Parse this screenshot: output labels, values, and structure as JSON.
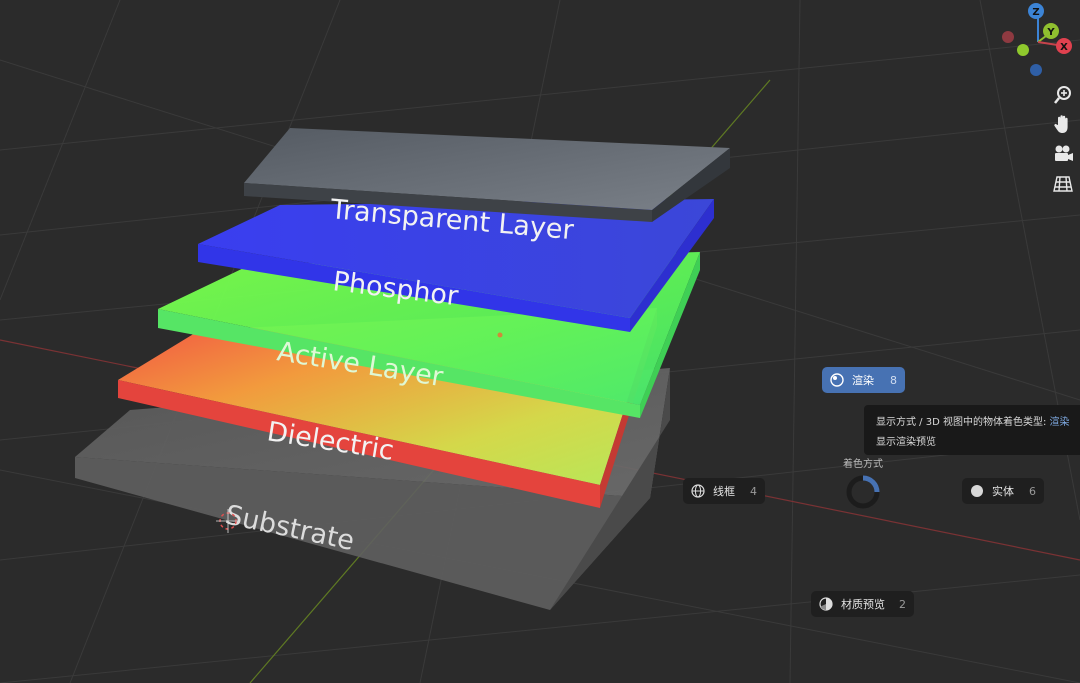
{
  "scene": {
    "layers": [
      {
        "name": "transparent-layer",
        "label": "Transparent Layer"
      },
      {
        "name": "phosphor",
        "label": "Phosphor"
      },
      {
        "name": "active-layer",
        "label": "Active Layer"
      },
      {
        "name": "dielectric",
        "label": "Dielectric"
      },
      {
        "name": "substrate",
        "label": "Substrate"
      }
    ]
  },
  "gizmo": {
    "z": "Z",
    "y": "Y",
    "x": "X"
  },
  "nav_tools": [
    "zoom-icon",
    "pan-hand-icon",
    "camera-icon",
    "grid-icon"
  ],
  "pie_menu": {
    "title": "着色方式",
    "items": {
      "render": {
        "label": "渲染",
        "key": "8",
        "icon": "render-sphere-icon"
      },
      "wireframe": {
        "label": "线框",
        "key": "4",
        "icon": "wireframe-globe-icon"
      },
      "solid": {
        "label": "实体",
        "key": "6",
        "icon": "solid-sphere-icon"
      },
      "material": {
        "label": "材质预览",
        "key": "2",
        "icon": "material-preview-icon"
      }
    }
  },
  "tooltip": {
    "line1_prefix": "显示方式 / 3D 视图中的物体着色类型: ",
    "line1_value": "渲染",
    "line2": "显示渲染预览"
  },
  "colors": {
    "background": "#2b2b2b",
    "accent": "#4772b3",
    "x_axis": "#c6434b",
    "y_axis": "#8fbf2f",
    "z_axis": "#3c84d6"
  }
}
